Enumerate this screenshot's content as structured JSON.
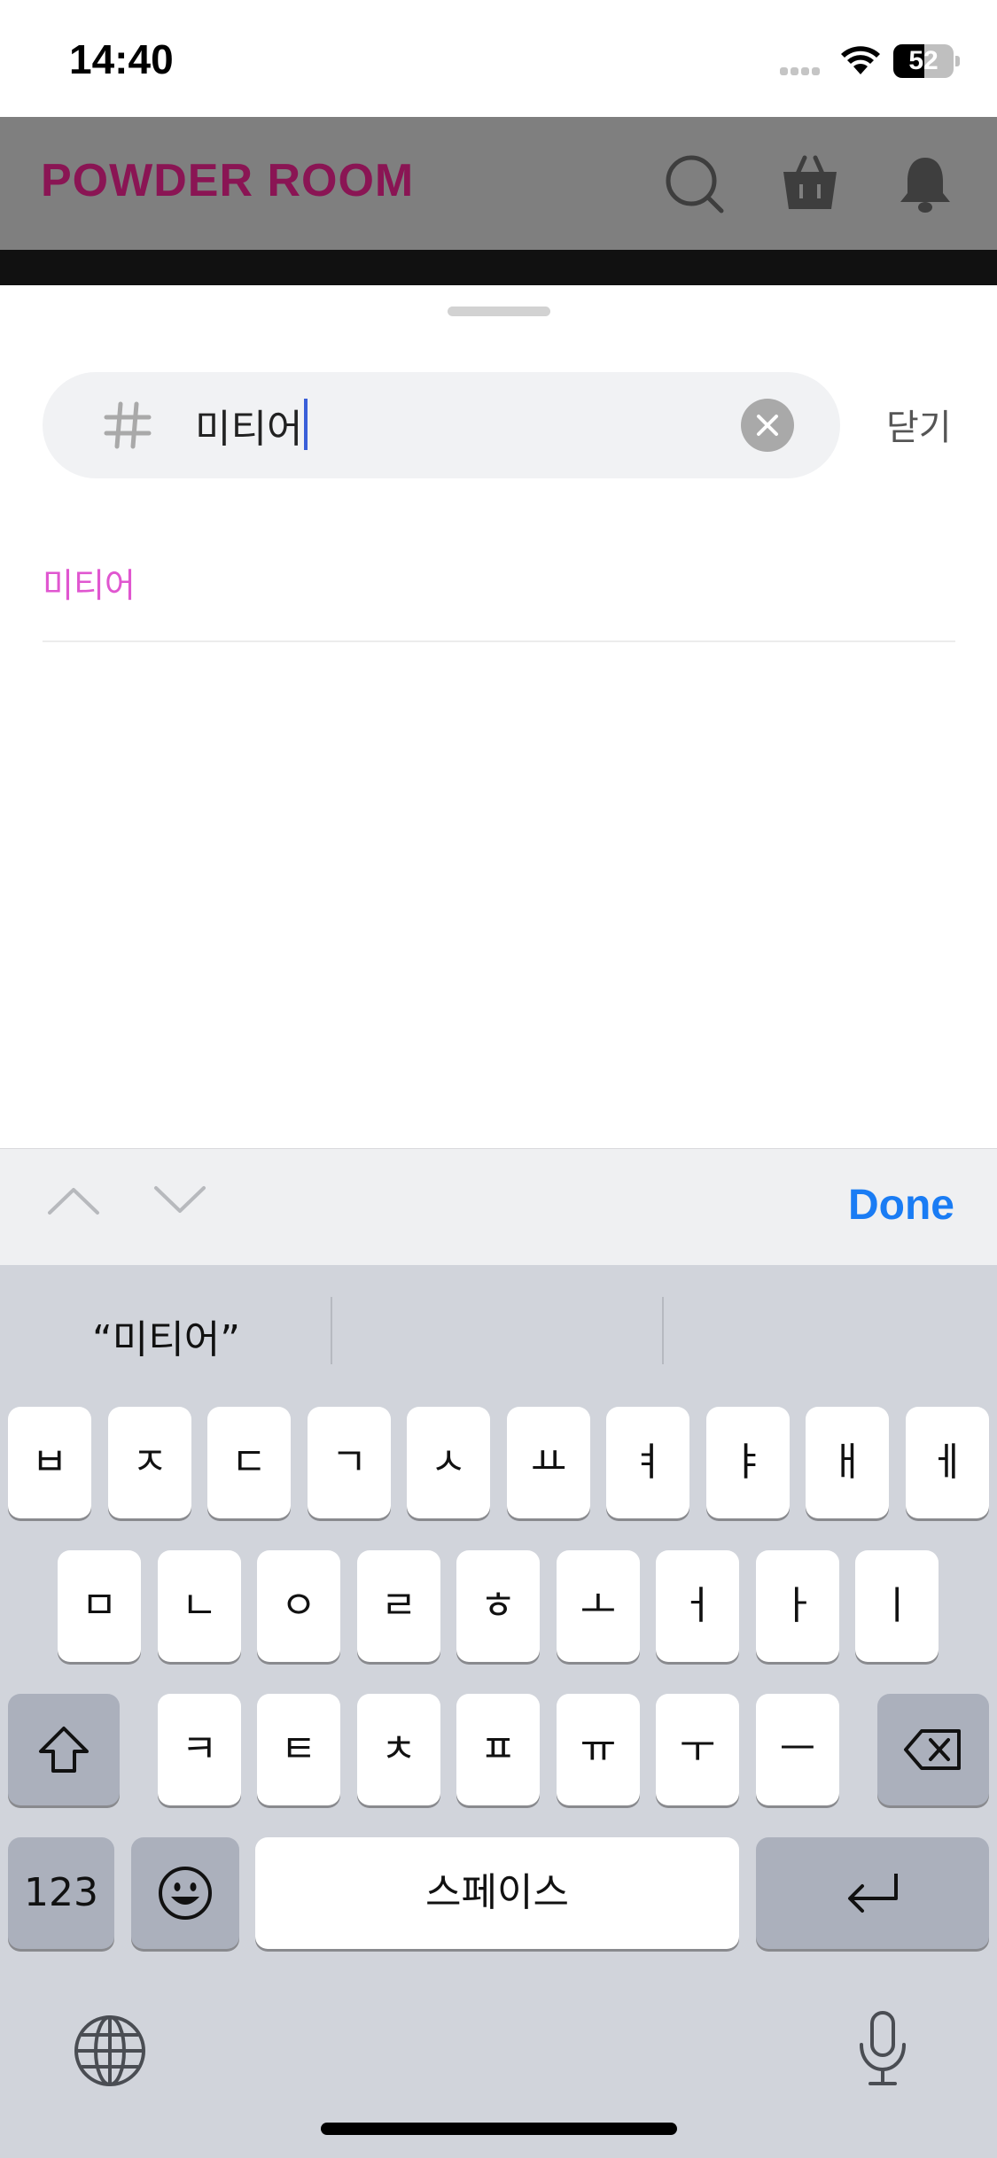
{
  "status_bar": {
    "time": "14:40",
    "battery_percent": "52",
    "battery_level": 0.52
  },
  "app_header": {
    "logo": "POWDER ROOM",
    "icons": [
      "search-icon",
      "basket-icon",
      "bell-icon"
    ]
  },
  "search": {
    "value": "미티어",
    "close_label": "닫기"
  },
  "results": [
    {
      "label": "미티어"
    }
  ],
  "accessory": {
    "done_label": "Done"
  },
  "keyboard": {
    "suggestions": [
      "“미티어”",
      "",
      ""
    ],
    "row1": [
      "ㅂ",
      "ㅈ",
      "ㄷ",
      "ㄱ",
      "ㅅ",
      "ㅛ",
      "ㅕ",
      "ㅑ",
      "ㅐ",
      "ㅔ"
    ],
    "row2": [
      "ㅁ",
      "ㄴ",
      "ㅇ",
      "ㄹ",
      "ㅎ",
      "ㅗ",
      "ㅓ",
      "ㅏ",
      "ㅣ"
    ],
    "row3": [
      "ㅋ",
      "ㅌ",
      "ㅊ",
      "ㅍ",
      "ㅠ",
      "ㅜ",
      "ㅡ"
    ],
    "numbers_label": "123",
    "space_label": "스페이스"
  },
  "colors": {
    "brand": "#8a1554",
    "accent": "#1a7cf4",
    "suggestion": "#e056d0",
    "caret": "#3a5fd9"
  }
}
